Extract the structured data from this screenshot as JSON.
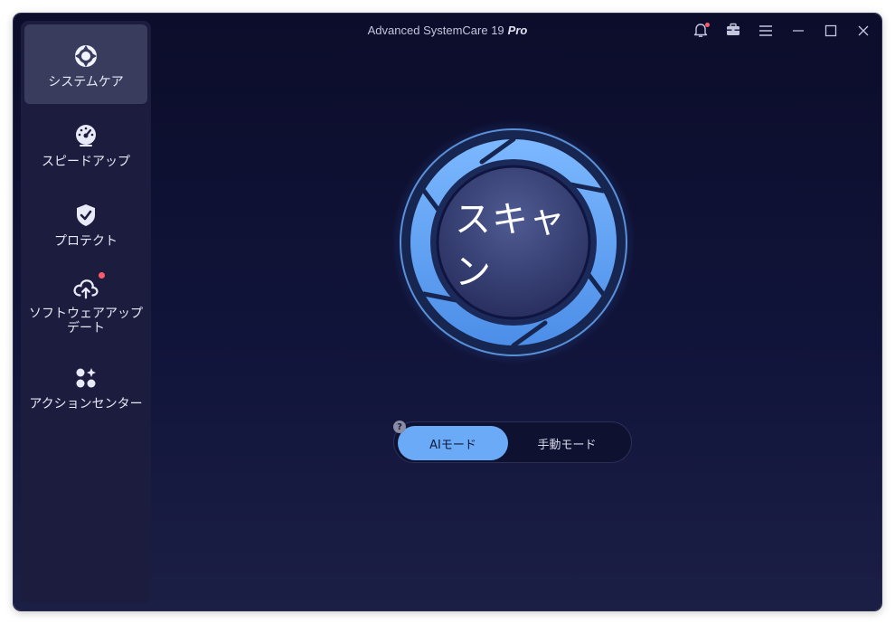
{
  "window": {
    "title": "Advanced SystemCare 19",
    "edition": "Pro"
  },
  "sidebar": {
    "items": [
      {
        "label": "システムケア",
        "icon": "system-care-icon",
        "active": true
      },
      {
        "label": "スピードアップ",
        "icon": "speedometer-icon",
        "active": false
      },
      {
        "label": "プロテクト",
        "icon": "shield-check-icon",
        "active": false
      },
      {
        "label": "ソフトウェアアップデート",
        "icon": "cloud-upload-icon",
        "active": false,
        "notification": true
      },
      {
        "label": "アクションセンター",
        "icon": "apps-grid-icon",
        "active": false
      }
    ]
  },
  "titlebar": {
    "icons": [
      "bell-icon",
      "toolbox-icon",
      "menu-icon",
      "minimize-icon",
      "maximize-icon",
      "close-icon"
    ],
    "bell_notification": true
  },
  "scan": {
    "label": "スキャン"
  },
  "mode": {
    "help": "?",
    "ai_label": "AIモード",
    "manual_label": "手動モード",
    "selected": "ai"
  },
  "colors": {
    "accent": "#6aaaf7",
    "background": "#0c0d2b",
    "sidebar": "#1c1d3e",
    "notification": "#ff5a6a"
  }
}
